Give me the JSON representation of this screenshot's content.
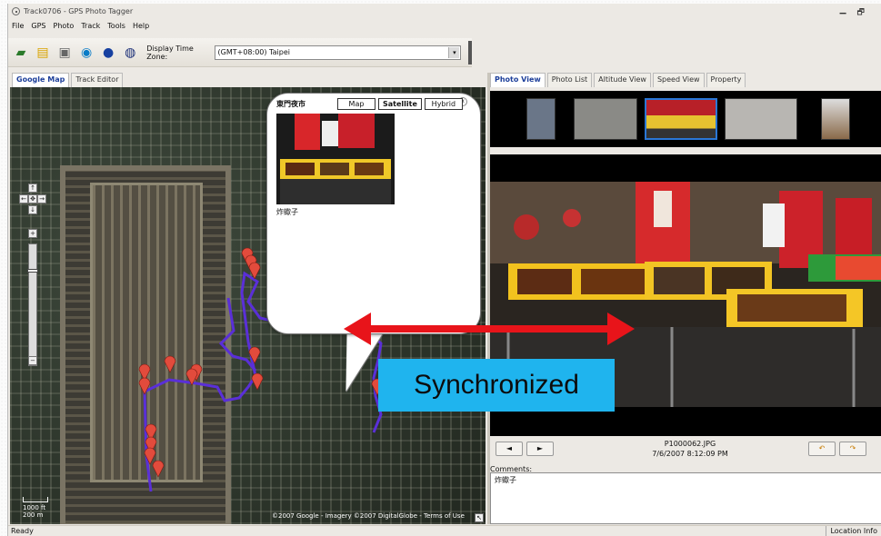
{
  "window": {
    "title": "Track0706 - GPS Photo Tagger",
    "min_glyph": "▁",
    "restore_glyph": "🗗"
  },
  "menu": [
    "File",
    "GPS",
    "Photo",
    "Track",
    "Tools",
    "Help"
  ],
  "toolbar": {
    "timezone_label": "Display Time Zone:",
    "timezone_value": "(GMT+08:00) Taipei",
    "buttons": [
      "open-track-icon",
      "open-folder-icon",
      "import-photos-icon",
      "internet-explorer-icon",
      "google-earth-icon",
      "export-kmz-icon"
    ],
    "dropdown_glyph": "▾"
  },
  "left_tabs": [
    "Google Map",
    "Track Editor"
  ],
  "map": {
    "types": [
      "Map",
      "Satellite",
      "Hybrid"
    ],
    "selected_type": "Satellite",
    "popup": {
      "title": "東門夜市",
      "caption": "炸蠍子",
      "close_glyph": "x"
    },
    "nav": {
      "up": "↑",
      "down": "↓",
      "left": "←",
      "right": "→",
      "center": "✥",
      "zoom_in": "+",
      "zoom_out": "−"
    },
    "scale": {
      "top": "1000 ft",
      "bottom": "200 m"
    },
    "copyright": "©2007 Google - Imagery ©2007 DigitalGlobe - Terms of Use",
    "corner_glyph": "↖"
  },
  "right_tabs": [
    "Photo View",
    "Photo List",
    "Altitude View",
    "Speed View",
    "Property"
  ],
  "photo": {
    "filename": "P1000062.JPG",
    "datetime": "7/6/2007 8:12:09 PM",
    "prev_glyph": "◄",
    "next_glyph": "►",
    "rotate_left_glyph": "↶",
    "rotate_right_glyph": "↷"
  },
  "comments": {
    "label": "Comments:",
    "value": "炸蠍子"
  },
  "status": {
    "left": "Ready",
    "right": "Location Info"
  },
  "annotation": {
    "label": "Synchronized",
    "color": "#1fb4ee",
    "arrow_color": "#e8141a"
  },
  "colors": {
    "track": "#5a2fd8",
    "marker": "#e24b3c"
  }
}
